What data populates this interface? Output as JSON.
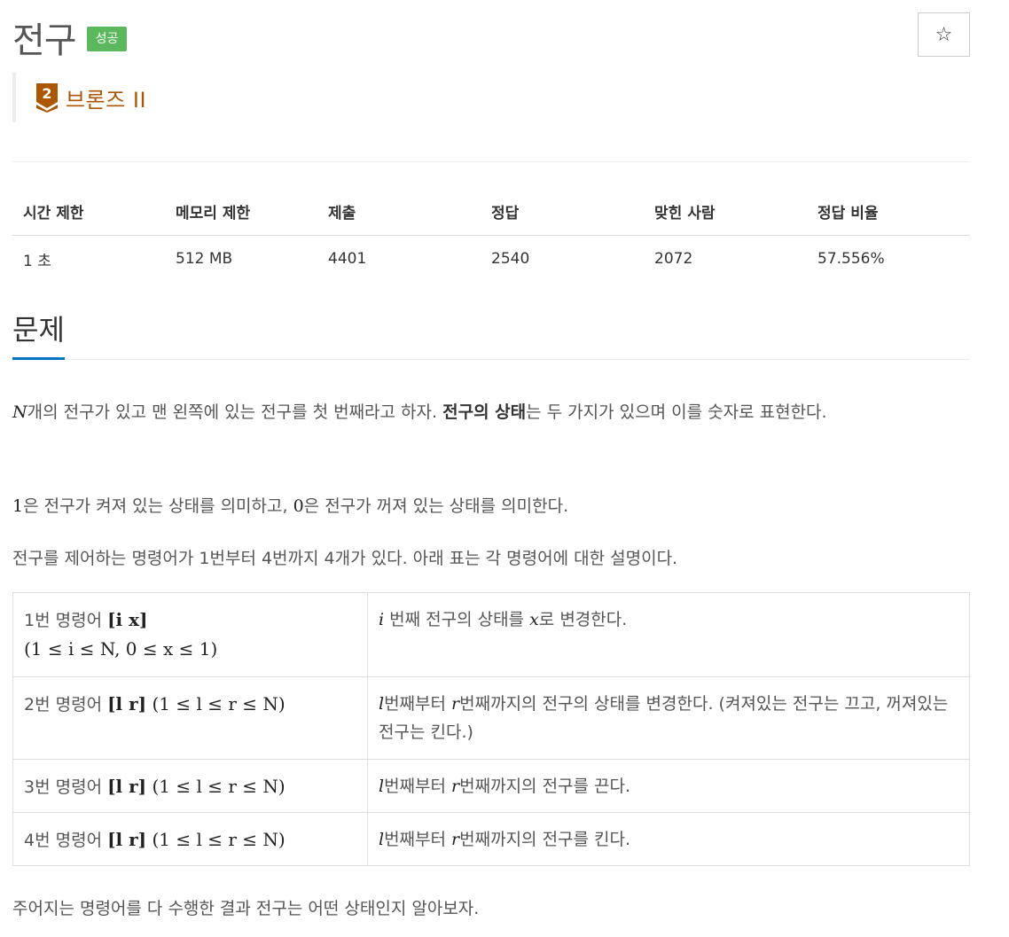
{
  "problem": {
    "title": "전구",
    "status_badge": "성공",
    "star_symbol": "☆",
    "tier": {
      "level_number": "2",
      "label": "브론즈 II",
      "color": "#ad5600"
    }
  },
  "stats": {
    "headers": [
      "시간 제한",
      "메모리 제한",
      "제출",
      "정답",
      "맞힌 사람",
      "정답 비율"
    ],
    "values": [
      "1 초",
      "512 MB",
      "4401",
      "2540",
      "2072",
      "57.556%"
    ]
  },
  "section": {
    "title": "문제"
  },
  "description": {
    "p1_var": "N",
    "p1_a": "개의 전구가 있고 맨 왼쪽에 있는 전구를 첫 번째라고 하자. ",
    "p1_bold": "전구의 상태",
    "p1_b": "는 두 가지가 있으며 이를 숫자로 표현한다.",
    "p2_one": "1",
    "p2_a": "은 전구가 켜져 있는 상태를 의미하고, ",
    "p2_zero": "0",
    "p2_b": "은 전구가 꺼져 있는 상태를 의미한다.",
    "p3": "전구를 제어하는 명령어가 1번부터 4번까지 4개가 있다. 아래 표는 각 명령어에 대한 설명이다.",
    "p4": "주어지는 명령어를 다 수행한 결과 전구는 어떤 상태인지 알아보자."
  },
  "commands": [
    {
      "name": "1번 명령어 ",
      "args": "[i x]",
      "range": "(1 ≤ i ≤ N, 0 ≤ x ≤ 1)",
      "desc_pre_var": "i",
      "desc_a": " 번째 전구의 상태를 ",
      "desc_var2": "x",
      "desc_b": "로 변경한다."
    },
    {
      "name": "2번 명령어 ",
      "args": "[l r]",
      "range": " (1 ≤ l ≤ r ≤ N)",
      "desc_pre_var": "l",
      "desc_a": "번째부터 ",
      "desc_var2": "r",
      "desc_b": "번째까지의 전구의 상태를 변경한다. (켜져있는 전구는 끄고, 꺼져있는 전구는 킨다.)"
    },
    {
      "name": "3번 명령어 ",
      "args": "[l r]",
      "range": " (1 ≤ l ≤ r ≤ N)",
      "desc_pre_var": "l",
      "desc_a": "번째부터 ",
      "desc_var2": "r",
      "desc_b": "번째까지의 전구를 끈다."
    },
    {
      "name": "4번 명령어 ",
      "args": "[l r]",
      "range": " (1 ≤ l ≤ r ≤ N)",
      "desc_pre_var": "l",
      "desc_a": "번째부터 ",
      "desc_var2": "r",
      "desc_b": "번째까지의 전구를 킨다."
    }
  ],
  "colors": {
    "badge_success": "#5cb85c",
    "section_underline": "#0076c0",
    "tier_bronze": "#ad5600"
  }
}
